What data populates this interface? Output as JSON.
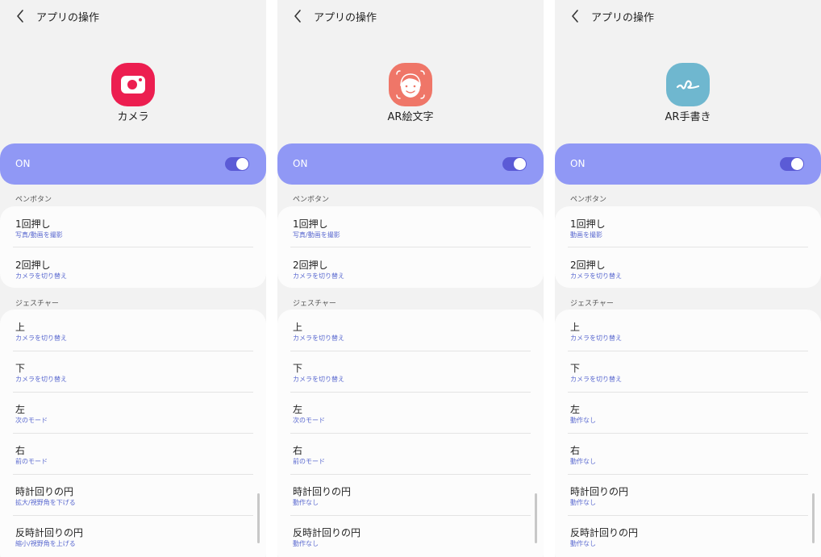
{
  "colors": {
    "on_bar": "#9098f5",
    "toggle": "#5b5bd6",
    "subtitle": "#5b6ad0",
    "camera_icon": "#ec1e50",
    "ar_emoji_icon": "#ef7668",
    "ar_doodle_icon": "#6fb7cf"
  },
  "screens": [
    {
      "header_title": "アプリの操作",
      "app_icon": "camera-icon",
      "app_name": "カメラ",
      "on_label": "ON",
      "toggle_on": true,
      "pen_section_label": "ペンボタン",
      "pen_rows": [
        {
          "title": "1回押し",
          "sub": "写真/動画を撮影"
        },
        {
          "title": "2回押し",
          "sub": "カメラを切り替え"
        }
      ],
      "gesture_section_label": "ジェスチャー",
      "gesture_rows": [
        {
          "title": "上",
          "sub": "カメラを切り替え"
        },
        {
          "title": "下",
          "sub": "カメラを切り替え"
        },
        {
          "title": "左",
          "sub": "次のモード"
        },
        {
          "title": "右",
          "sub": "前のモード"
        },
        {
          "title": "時計回りの円",
          "sub": "拡大/視野角を下げる"
        },
        {
          "title": "反時計回りの円",
          "sub": "縮小/視野角を上げる"
        }
      ]
    },
    {
      "header_title": "アプリの操作",
      "app_icon": "ar-emoji-icon",
      "app_name": "AR絵文字",
      "on_label": "ON",
      "toggle_on": true,
      "pen_section_label": "ペンボタン",
      "pen_rows": [
        {
          "title": "1回押し",
          "sub": "写真/動画を撮影"
        },
        {
          "title": "2回押し",
          "sub": "カメラを切り替え"
        }
      ],
      "gesture_section_label": "ジェスチャー",
      "gesture_rows": [
        {
          "title": "上",
          "sub": "カメラを切り替え"
        },
        {
          "title": "下",
          "sub": "カメラを切り替え"
        },
        {
          "title": "左",
          "sub": "次のモード"
        },
        {
          "title": "右",
          "sub": "前のモード"
        },
        {
          "title": "時計回りの円",
          "sub": "動作なし"
        },
        {
          "title": "反時計回りの円",
          "sub": "動作なし"
        }
      ]
    },
    {
      "header_title": "アプリの操作",
      "app_icon": "ar-doodle-icon",
      "app_name": "AR手書き",
      "on_label": "ON",
      "toggle_on": true,
      "pen_section_label": "ペンボタン",
      "pen_rows": [
        {
          "title": "1回押し",
          "sub": "動画を撮影"
        },
        {
          "title": "2回押し",
          "sub": "カメラを切り替え"
        }
      ],
      "gesture_section_label": "ジェスチャー",
      "gesture_rows": [
        {
          "title": "上",
          "sub": "カメラを切り替え"
        },
        {
          "title": "下",
          "sub": "カメラを切り替え"
        },
        {
          "title": "左",
          "sub": "動作なし"
        },
        {
          "title": "右",
          "sub": "動作なし"
        },
        {
          "title": "時計回りの円",
          "sub": "動作なし"
        },
        {
          "title": "反時計回りの円",
          "sub": "動作なし"
        }
      ]
    }
  ]
}
